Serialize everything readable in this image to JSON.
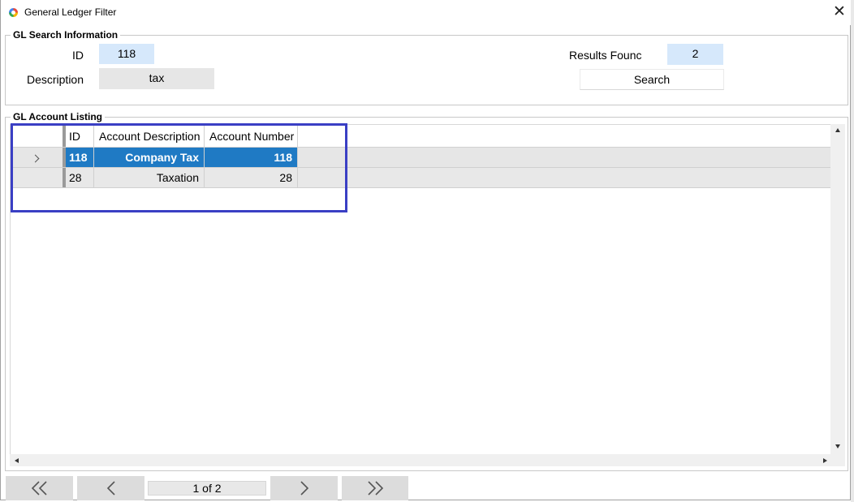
{
  "window": {
    "title": "General Ledger Filter",
    "close_icon": "close-icon"
  },
  "search_group": {
    "legend": "GL Search Information",
    "id_label": "ID",
    "id_value": "118",
    "description_label": "Description",
    "description_value": "tax",
    "results_label": "Results Founc",
    "results_value": "2",
    "search_button": "Search"
  },
  "listing_group": {
    "legend": "GL Account Listing",
    "columns": [
      "ID",
      "Account Description",
      "Account Number"
    ],
    "rows": [
      {
        "id": "118",
        "description": "Company Tax",
        "number": "118",
        "selected": true
      },
      {
        "id": "28",
        "description": "Taxation",
        "number": "28",
        "selected": false
      }
    ]
  },
  "pager": {
    "text": "1 of 2"
  },
  "colors": {
    "selection": "#1f7ac4",
    "highlight_box": "#3a3fc4",
    "input_blue": "#d6e8fb"
  }
}
